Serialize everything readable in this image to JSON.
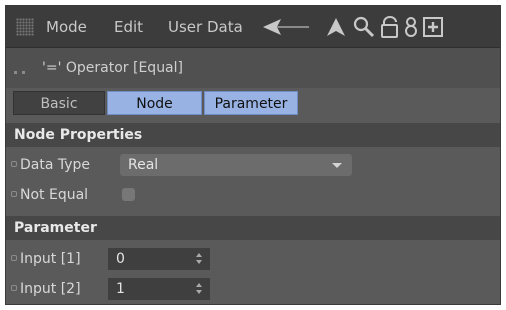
{
  "menubar": {
    "items": [
      "Mode",
      "Edit",
      "User Data"
    ],
    "icons": [
      "back-arrow-icon",
      "cursor-up-icon",
      "search-icon",
      "lock-icon",
      "link-icon",
      "new-panel-icon"
    ]
  },
  "title": "'=' Operator [Equal]",
  "tabs": {
    "basic": "Basic",
    "node": "Node",
    "parameter": "Parameter"
  },
  "sections": {
    "node_properties": "Node Properties",
    "parameter": "Parameter"
  },
  "node_properties": {
    "data_type_label": "Data Type",
    "data_type_value": "Real",
    "not_equal_label": "Not Equal",
    "not_equal_checked": false
  },
  "parameter": {
    "input1_label": "Input [1]",
    "input1_value": "0",
    "input2_label": "Input [2]",
    "input2_value": "1"
  },
  "colors": {
    "tab_active": "#98b3e3",
    "panel_bg": "#5a5a5a",
    "header_bg": "#474747"
  }
}
